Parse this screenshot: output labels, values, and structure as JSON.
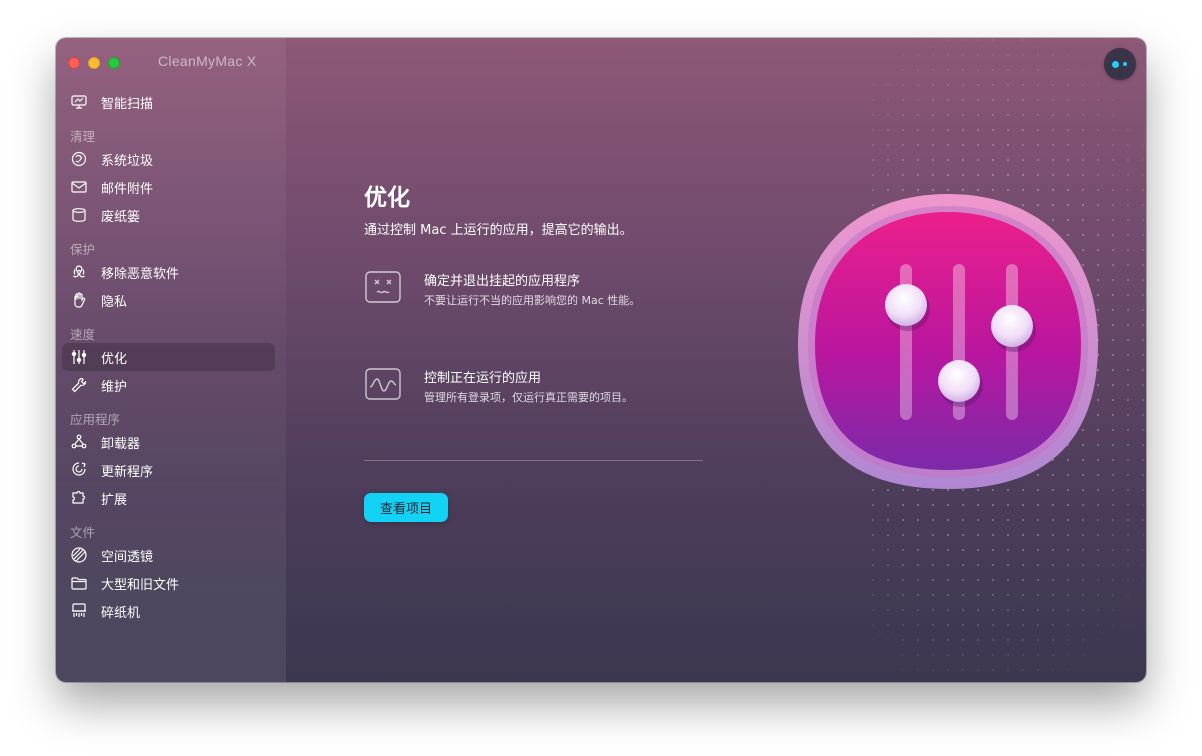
{
  "window": {
    "title": "CleanMyMac X"
  },
  "sidebar": {
    "top_item": {
      "label": "智能扫描",
      "icon": "monitor-scan-icon"
    },
    "sections": [
      {
        "header": "清理",
        "items": [
          {
            "label": "系统垃圾",
            "icon": "system-junk-icon"
          },
          {
            "label": "邮件附件",
            "icon": "mail-icon"
          },
          {
            "label": "废纸篓",
            "icon": "trash-bin-icon"
          }
        ]
      },
      {
        "header": "保护",
        "items": [
          {
            "label": "移除恶意软件",
            "icon": "biohazard-icon"
          },
          {
            "label": "隐私",
            "icon": "hand-icon"
          }
        ]
      },
      {
        "header": "速度",
        "items": [
          {
            "label": "优化",
            "icon": "sliders-icon",
            "active": true
          },
          {
            "label": "维护",
            "icon": "wrench-icon"
          }
        ]
      },
      {
        "header": "应用程序",
        "items": [
          {
            "label": "卸载器",
            "icon": "uninstaller-icon"
          },
          {
            "label": "更新程序",
            "icon": "updater-icon"
          },
          {
            "label": "扩展",
            "icon": "extensions-icon"
          }
        ]
      },
      {
        "header": "文件",
        "items": [
          {
            "label": "空间透镜",
            "icon": "space-lens-icon"
          },
          {
            "label": "大型和旧文件",
            "icon": "folder-icon"
          },
          {
            "label": "碎纸机",
            "icon": "shredder-icon"
          }
        ]
      }
    ]
  },
  "main": {
    "title": "优化",
    "subtitle": "通过控制 Mac 上运行的应用，提高它的输出。",
    "features": [
      {
        "title": "确定并退出挂起的应用程序",
        "description": "不要让运行不当的应用影响您的 Mac 性能。",
        "icon": "frozen-face-icon"
      },
      {
        "title": "控制正在运行的应用",
        "description": "管理所有登录项，仅运行真正需要的项目。",
        "icon": "activity-wave-icon"
      }
    ],
    "action_button": "查看项目"
  },
  "colors": {
    "accent": "#12d3f5",
    "hero_top": "#e8208a",
    "hero_bottom": "#7a2bab"
  }
}
